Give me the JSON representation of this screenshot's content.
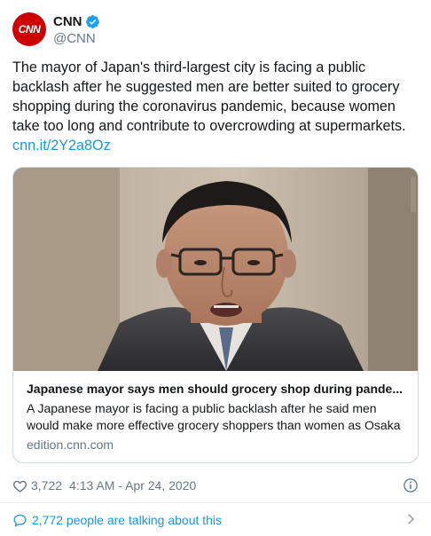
{
  "author": {
    "avatar_text": "CNN",
    "display_name": "CNN",
    "handle": "@CNN",
    "verified_icon": "verified-badge-icon"
  },
  "tweet": {
    "text": "The mayor of Japan's third-largest city is facing a public backlash after he suggested men are better suited to grocery shopping during the coronavirus pandemic, because women take too long and contribute to overcrowding at supermarkets.",
    "link": "cnn.it/2Y2a8Oz"
  },
  "card": {
    "title": "Japanese mayor says men should grocery shop during pande...",
    "description": "A Japanese mayor is facing a public backlash after he said men would make more effective grocery shoppers than women as Osaka",
    "domain": "edition.cnn.com"
  },
  "meta": {
    "likes": "3,722",
    "timestamp": "4:13 AM - Apr 24, 2020"
  },
  "footer": {
    "talking": "2,772 people are talking about this"
  },
  "colors": {
    "brand_red": "#cc0000",
    "link_blue": "#1b95e0",
    "muted_gray": "#657786"
  }
}
